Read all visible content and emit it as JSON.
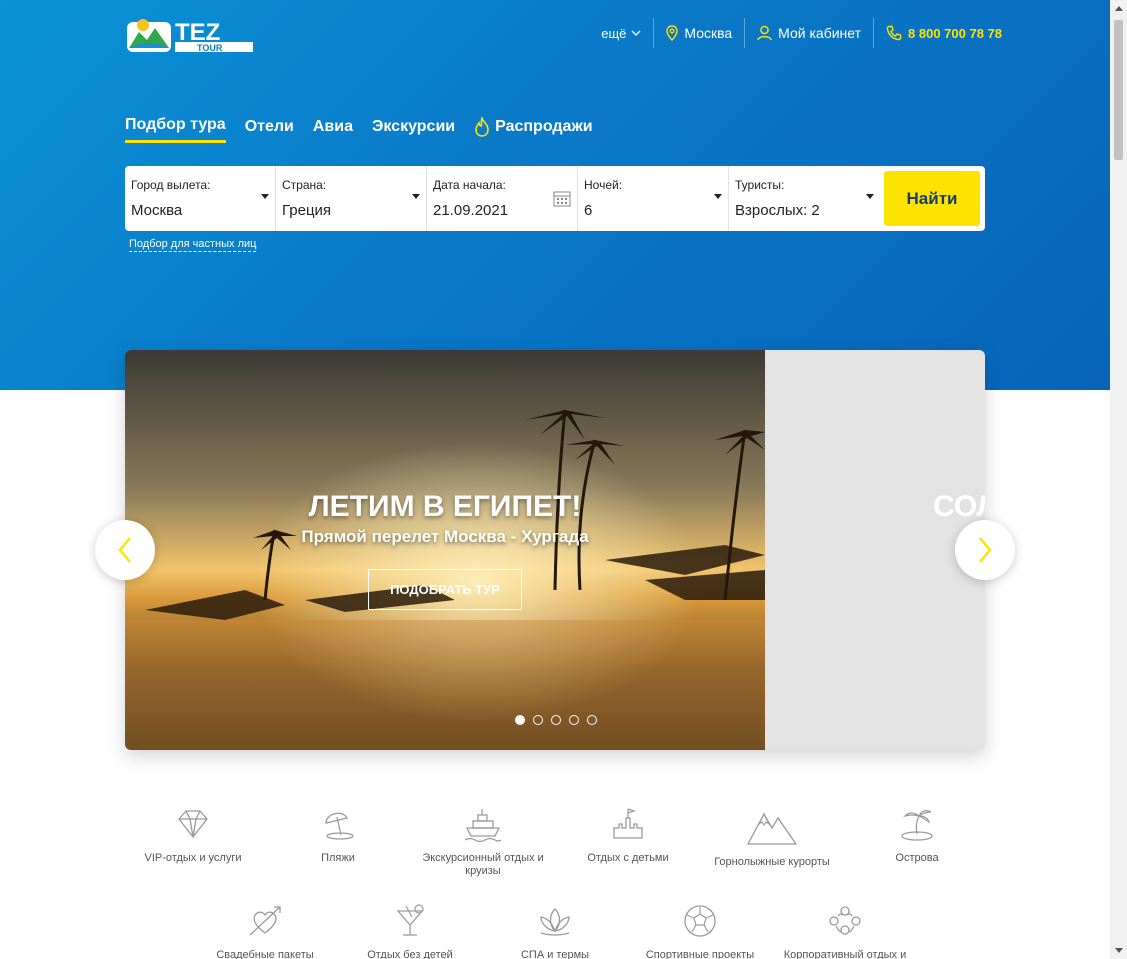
{
  "header": {
    "logo_alt": "TEZ TOUR",
    "more_label": "ещё",
    "city": "Москва",
    "cabinet": "Мой кабинет",
    "phone": "8 800 700 78 78"
  },
  "tabs": [
    {
      "label": "Подбор тура"
    },
    {
      "label": "Отели"
    },
    {
      "label": "Авиа"
    },
    {
      "label": "Экскурсии"
    },
    {
      "label": "Распродажи"
    }
  ],
  "search": {
    "fields": [
      {
        "label": "Город вылета:",
        "value": "Москва"
      },
      {
        "label": "Страна:",
        "value": "Греция"
      },
      {
        "label": "Дата начала:",
        "value": "21.09.2021"
      },
      {
        "label": "Ночей:",
        "value": "6"
      },
      {
        "label": "Туристы:",
        "value": "Взрослых: 2"
      }
    ],
    "find_label": "Найти",
    "private_link": "Подбор для частных лиц"
  },
  "slider": {
    "title": "ЛЕТИМ В ЕГИПЕТ!",
    "subtitle": "Прямой перелет Москва - Хургада",
    "button": "ПОДОБРАТЬ ТУР",
    "next_peek": "СОЛ",
    "dots_total": 5,
    "active_dot": 1
  },
  "categories": [
    {
      "label": "VIP-отдых и услуги",
      "icon": "diamond-icon"
    },
    {
      "label": "Пляжи",
      "icon": "beach-umbrella-icon"
    },
    {
      "label": "Экскурсионный отдых и круизы",
      "icon": "ship-icon"
    },
    {
      "label": "Отдых с детьми",
      "icon": "sandcastle-icon"
    },
    {
      "label": "Горнолыжные курорты",
      "icon": "mountains-icon"
    },
    {
      "label": "Острова",
      "icon": "island-icon"
    },
    {
      "label": "Свадебные пакеты",
      "icon": "heart-arrow-icon"
    },
    {
      "label": "Отдых без детей",
      "icon": "cocktail-icon"
    },
    {
      "label": "СПА и термы",
      "icon": "lotus-icon"
    },
    {
      "label": "Спортивные проекты",
      "icon": "ball-icon"
    },
    {
      "label": "Корпоративный отдых и",
      "icon": "group-icon"
    }
  ],
  "colors": {
    "brand_blue": "#0a7bc9",
    "accent_yellow": "#ffe300"
  }
}
